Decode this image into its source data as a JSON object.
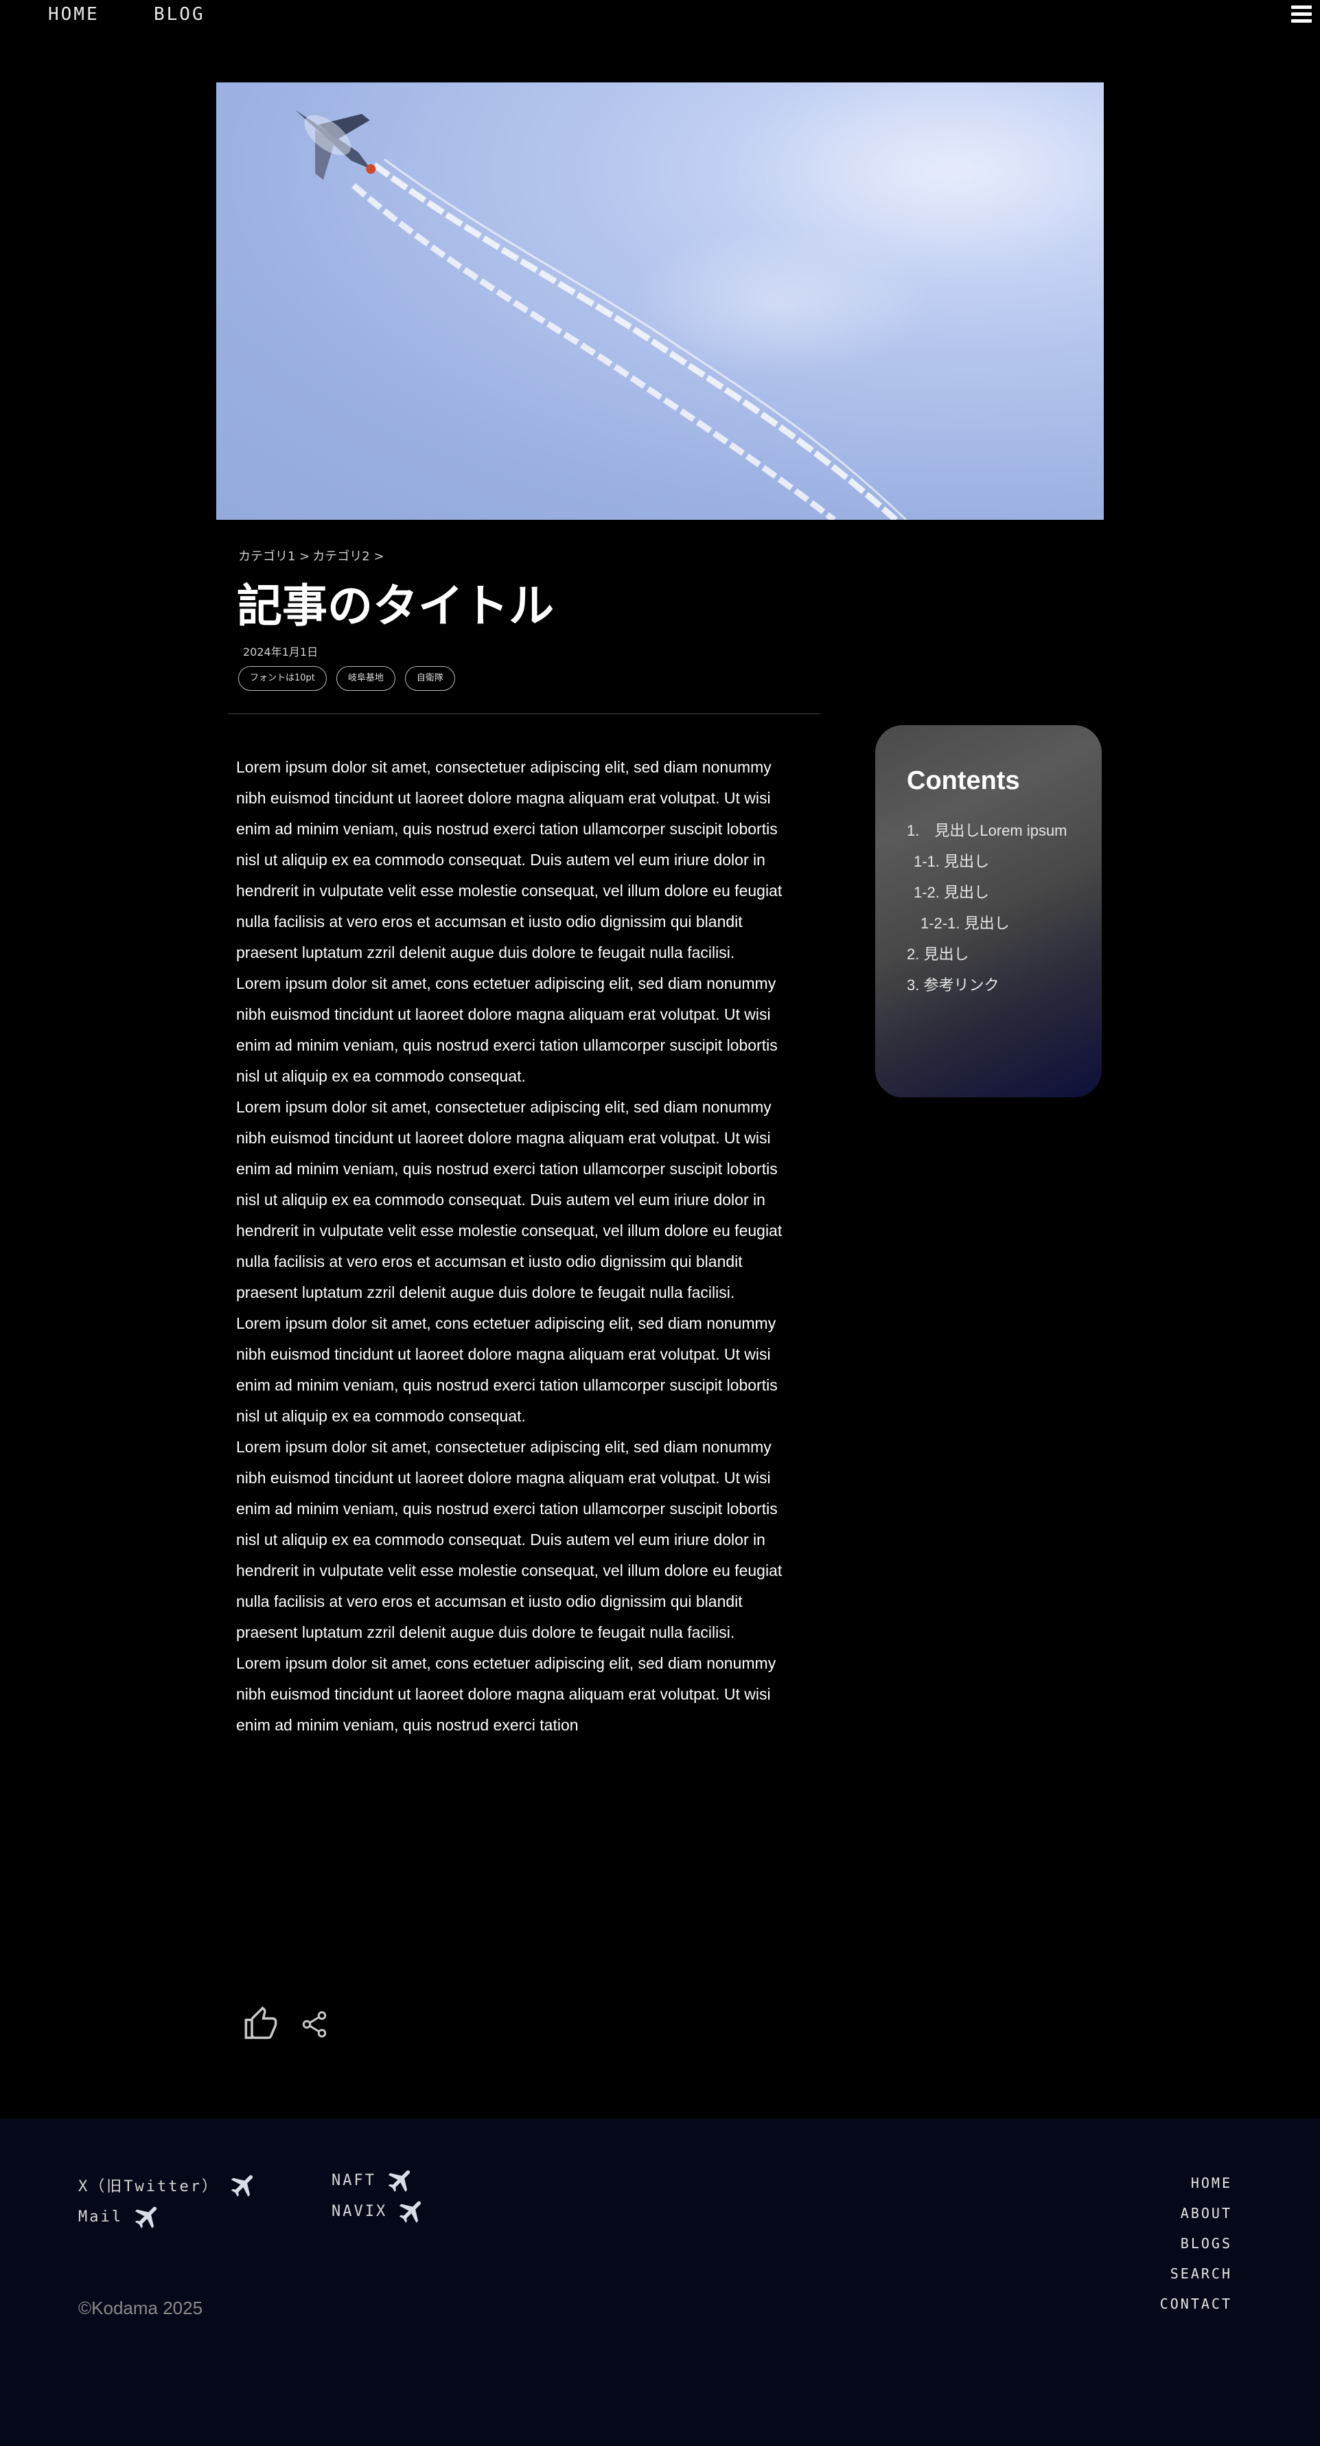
{
  "nav": {
    "home_label": "HOME",
    "blog_label": "BLOG"
  },
  "article": {
    "breadcrumb": [
      "カテゴリ1 >",
      "カテゴリ2 >"
    ],
    "title": "記事のタイトル",
    "date": "2024年1月1日",
    "tags": [
      "フォントは10pt",
      "岐阜基地",
      "自衛隊"
    ],
    "paragraphs": [
      "Lorem ipsum dolor sit amet, consectetuer adipiscing elit, sed diam nonummy nibh euismod tincidunt ut laoreet dolore magna aliquam erat volutpat. Ut wisi enim ad minim veniam, quis nostrud exerci tation ullamcorper suscipit lobortis nisl ut aliquip ex ea commodo consequat. Duis autem vel eum iriure dolor in hendrerit in vulputate velit esse molestie consequat, vel illum dolore eu feugiat nulla facilisis at vero eros et accumsan et iusto odio dignissim qui blandit praesent luptatum zzril delenit augue duis dolore te feugait nulla facilisi.",
      "Lorem ipsum dolor sit amet, cons ectetuer adipiscing elit, sed diam nonummy nibh euismod tincidunt ut laoreet dolore magna aliquam erat volutpat. Ut wisi enim ad minim veniam, quis nostrud exerci tation ullamcorper suscipit lobortis nisl ut aliquip ex ea commodo consequat.",
      "Lorem ipsum dolor sit amet, consectetuer adipiscing elit, sed diam nonummy nibh euismod tincidunt ut laoreet dolore magna aliquam erat volutpat. Ut wisi enim ad minim veniam, quis nostrud exerci tation ullamcorper suscipit lobortis nisl ut aliquip ex ea commodo consequat. Duis autem vel eum iriure dolor in hendrerit in vulputate velit esse molestie consequat, vel illum dolore eu feugiat nulla facilisis at vero eros et accumsan et iusto odio dignissim qui blandit praesent luptatum zzril delenit augue duis dolore te feugait nulla facilisi.",
      "Lorem ipsum dolor sit amet, cons ectetuer adipiscing elit, sed diam nonummy nibh euismod tincidunt ut laoreet dolore magna aliquam erat volutpat. Ut wisi enim ad minim veniam, quis nostrud exerci tation ullamcorper suscipit lobortis nisl ut aliquip ex ea commodo consequat.",
      "Lorem ipsum dolor sit amet, consectetuer adipiscing elit, sed diam nonummy nibh euismod tincidunt ut laoreet dolore magna aliquam erat volutpat. Ut wisi enim ad minim veniam, quis nostrud exerci tation ullamcorper suscipit lobortis nisl ut aliquip ex ea commodo consequat. Duis autem vel eum iriure dolor in hendrerit in vulputate velit esse molestie consequat, vel illum dolore eu feugiat nulla facilisis at vero eros et accumsan et iusto odio dignissim qui blandit praesent luptatum zzril delenit augue duis dolore te feugait nulla facilisi.",
      "Lorem ipsum dolor sit amet, cons ectetuer adipiscing elit, sed diam nonummy nibh euismod tincidunt ut laoreet dolore magna aliquam erat volutpat. Ut wisi enim ad minim veniam, quis nostrud exerci tation"
    ]
  },
  "toc": {
    "title": "Contents",
    "items": [
      "1.　見出しLorem ipsum",
      "1-1. 見出し",
      "1-2. 見出し",
      "1-2-1. 見出し",
      "2. 見出し",
      "3. 参考リンク"
    ]
  },
  "footer": {
    "links_left": [
      "X（旧Twitter）",
      "Mail"
    ],
    "links_mid": [
      "NAFT",
      "NAVIX"
    ],
    "links_right": [
      "HOME",
      "ABOUT",
      "BLOGS",
      "SEARCH",
      "CONTACT"
    ],
    "copyright": "©Kodama 2025"
  },
  "icons": {
    "menu": "hamburger-icon",
    "like": "thumbs-up-icon",
    "share": "share-icon",
    "plane": "airplane-icon"
  },
  "colors": {
    "background": "#000000",
    "footer_bg": "#050818",
    "toc_accent": "#0d0f3a",
    "sky": "#9cb1e2"
  }
}
